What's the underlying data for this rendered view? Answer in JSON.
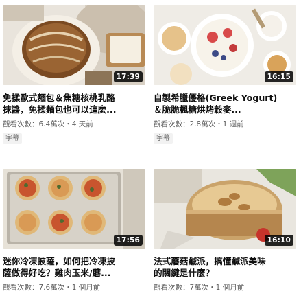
{
  "videos": [
    {
      "duration": "17:39",
      "title_line1": "免揉歐式麵包＆焦糖核桃乳酪",
      "title_line2": "抹醬，免揉麵包也可以這麼...",
      "meta": "觀看次數：6.4萬次・4 天前",
      "badge": "字幕"
    },
    {
      "duration": "16:15",
      "title_line1": "自製希臘優格(Greek Yogurt)",
      "title_line2": "＆脆脆楓糖烘烤穀麥...",
      "meta": "觀看次數：2.8萬次・1 週前",
      "badge": "字幕"
    },
    {
      "duration": "17:56",
      "title_line1": "迷你冷凍披薩，如何把冷凍披",
      "title_line2": "薩做得好吃？雞肉玉米/蘑...",
      "meta": "觀看次數：7.6萬次・1 個月前"
    },
    {
      "duration": "16:10",
      "title_line1": "法式蘑菇鹹派，搞懂鹹派美味",
      "title_line2": "的關鍵是什麼？",
      "meta": "觀看次數：7萬次・1 個月前"
    }
  ]
}
